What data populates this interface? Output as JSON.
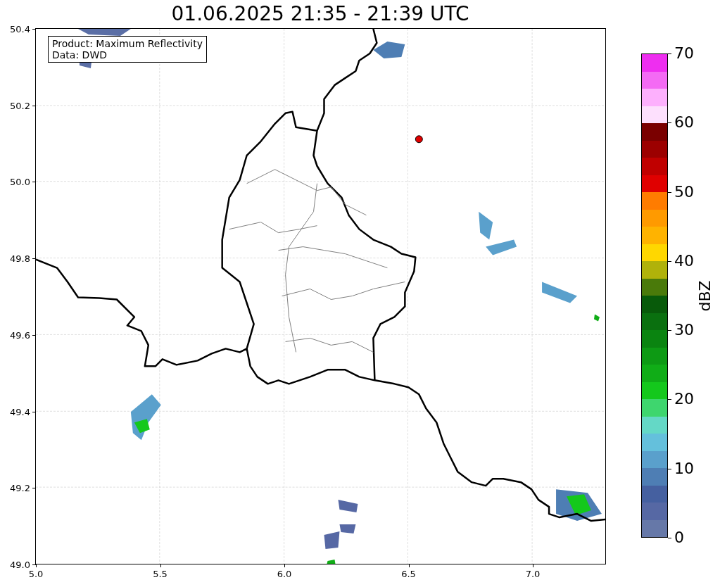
{
  "title": "01.06.2025 21:35 - 21:39 UTC",
  "info_box": [
    "Product: Maximum Reflectivity",
    "Data: DWD"
  ],
  "map": {
    "x_ticks": [
      "5.0",
      "5.5",
      "6.0",
      "6.5",
      "7.0"
    ],
    "y_ticks": [
      "50.4",
      "50.2",
      "50.0",
      "49.8",
      "49.6",
      "49.4",
      "49.2",
      "49.0"
    ]
  },
  "colorbar": {
    "label": "dBZ",
    "ticks": [
      "70",
      "60",
      "50",
      "40",
      "30",
      "20",
      "10",
      "0"
    ],
    "bins": [
      {
        "color": "#ee2ef0"
      },
      {
        "color": "#f46af4"
      },
      {
        "color": "#fdb0fd"
      },
      {
        "color": "#fde0fd"
      },
      {
        "color": "#7a0000"
      },
      {
        "color": "#9c0000"
      },
      {
        "color": "#c00000"
      },
      {
        "color": "#e00000"
      },
      {
        "color": "#ff7c00"
      },
      {
        "color": "#ff9a00"
      },
      {
        "color": "#ffb300"
      },
      {
        "color": "#ffd700"
      },
      {
        "color": "#b0b20a"
      },
      {
        "color": "#4a7a0a"
      },
      {
        "color": "#085a0a"
      },
      {
        "color": "#0a700f"
      },
      {
        "color": "#0a8410"
      },
      {
        "color": "#0d9a14"
      },
      {
        "color": "#10ad17"
      },
      {
        "color": "#14c81c"
      },
      {
        "color": "#3ed66e"
      },
      {
        "color": "#64d8c6"
      },
      {
        "color": "#64c0dc"
      },
      {
        "color": "#5aa0cc"
      },
      {
        "color": "#4e7eb4"
      },
      {
        "color": "#4560a0"
      },
      {
        "color": "#5668a4"
      },
      {
        "color": "#6678a8"
      }
    ]
  }
}
